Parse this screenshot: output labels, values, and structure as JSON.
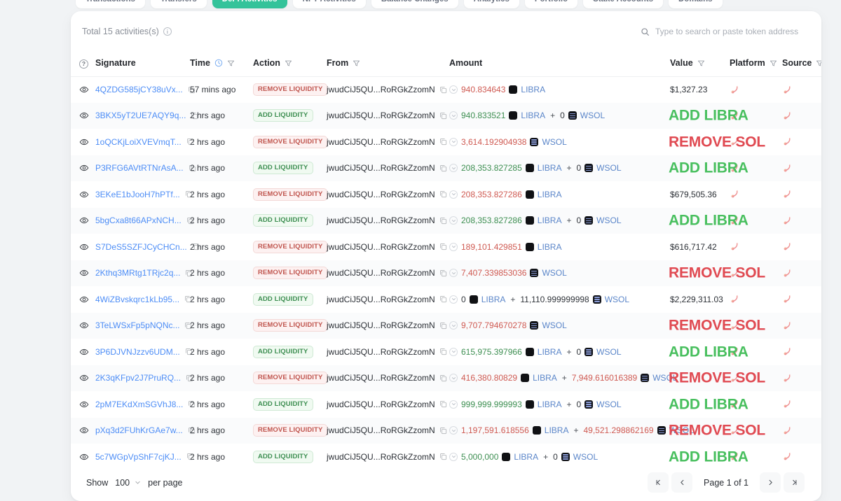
{
  "tabs": [
    {
      "label": "Transactions",
      "active": false
    },
    {
      "label": "Transfers",
      "active": false
    },
    {
      "label": "DeFi Activities",
      "active": true
    },
    {
      "label": "NFT Activities",
      "active": false
    },
    {
      "label": "Balance Changes",
      "active": false
    },
    {
      "label": "Analytics",
      "active": false
    },
    {
      "label": "Portfolio",
      "active": false
    },
    {
      "label": "Stake Accounts",
      "active": false
    },
    {
      "label": "Domains",
      "active": false
    }
  ],
  "header": {
    "total_label": "Total 15 activities(s)",
    "search_placeholder": "Type to search or paste token address",
    "search_value": ""
  },
  "columns": {
    "signature": "Signature",
    "time": "Time",
    "action": "Action",
    "from": "From",
    "amount": "Amount",
    "value": "Value",
    "platform": "Platform",
    "source": "Source"
  },
  "rows": [
    {
      "signature": "4QZDG585jCY38uVx...",
      "time": "57 mins ago",
      "action": "REMOVE LIQUIDITY",
      "action_type": "remove",
      "from": "jwudCiJ5QU...RoRGkZzomN",
      "amount": [
        {
          "num": "940.834643",
          "sign": "neg",
          "token": "LIBRA",
          "icon": "libra"
        }
      ],
      "value": "$1,327.23",
      "big_value": null
    },
    {
      "signature": "3BKX5yT2UE7AQY9q...",
      "time": "2 hrs ago",
      "action": "ADD LIQUIDITY",
      "action_type": "add",
      "from": "jwudCiJ5QU...RoRGkZzomN",
      "amount": [
        {
          "num": "940.833521",
          "sign": "pos",
          "token": "LIBRA",
          "icon": "libra"
        },
        {
          "num": "0",
          "sign": "plain",
          "token": "WSOL",
          "icon": "wsol"
        }
      ],
      "value": null,
      "big_value": "ADD LIBRA",
      "big_type": "add"
    },
    {
      "signature": "1oQCKjLoiXVEVmqT...",
      "time": "2 hrs ago",
      "action": "REMOVE LIQUIDITY",
      "action_type": "remove",
      "from": "jwudCiJ5QU...RoRGkZzomN",
      "amount": [
        {
          "num": "3,614.192904938",
          "sign": "neg",
          "token": "WSOL",
          "icon": "wsol"
        }
      ],
      "value": null,
      "big_value": "REMOVE SOL",
      "big_type": "rem"
    },
    {
      "signature": "P3RFG6AVtRTNrAsA...",
      "time": "2 hrs ago",
      "action": "ADD LIQUIDITY",
      "action_type": "add",
      "from": "jwudCiJ5QU...RoRGkZzomN",
      "amount": [
        {
          "num": "208,353.827285",
          "sign": "pos",
          "token": "LIBRA",
          "icon": "libra"
        },
        {
          "num": "0",
          "sign": "plain",
          "token": "WSOL",
          "icon": "wsol"
        }
      ],
      "value": null,
      "big_value": "ADD LIBRA",
      "big_type": "add"
    },
    {
      "signature": "3EKeE1bJooH7hPTf...",
      "time": "2 hrs ago",
      "action": "REMOVE LIQUIDITY",
      "action_type": "remove",
      "from": "jwudCiJ5QU...RoRGkZzomN",
      "amount": [
        {
          "num": "208,353.827286",
          "sign": "neg",
          "token": "LIBRA",
          "icon": "libra"
        }
      ],
      "value": "$679,505.36",
      "big_value": null
    },
    {
      "signature": "5bgCxa8t66APxNCH...",
      "time": "2 hrs ago",
      "action": "ADD LIQUIDITY",
      "action_type": "add",
      "from": "jwudCiJ5QU...RoRGkZzomN",
      "amount": [
        {
          "num": "208,353.827286",
          "sign": "pos",
          "token": "LIBRA",
          "icon": "libra"
        },
        {
          "num": "0",
          "sign": "plain",
          "token": "WSOL",
          "icon": "wsol"
        }
      ],
      "value": null,
      "big_value": "ADD LIBRA",
      "big_type": "add"
    },
    {
      "signature": "S7DeS5SZFJCyCHCn...",
      "time": "2 hrs ago",
      "action": "REMOVE LIQUIDITY",
      "action_type": "remove",
      "from": "jwudCiJ5QU...RoRGkZzomN",
      "amount": [
        {
          "num": "189,101.429851",
          "sign": "neg",
          "token": "LIBRA",
          "icon": "libra"
        }
      ],
      "value": "$616,717.42",
      "big_value": null
    },
    {
      "signature": "2Kthq3MRtg1TRjc2q...",
      "time": "2 hrs ago",
      "action": "REMOVE LIQUIDITY",
      "action_type": "remove",
      "from": "jwudCiJ5QU...RoRGkZzomN",
      "amount": [
        {
          "num": "7,407.339853036",
          "sign": "neg",
          "token": "WSOL",
          "icon": "wsol"
        }
      ],
      "value": null,
      "big_value": "REMOVE SOL",
      "big_type": "rem"
    },
    {
      "signature": "4WiZBvskqrc1kLb95...",
      "time": "2 hrs ago",
      "action": "ADD LIQUIDITY",
      "action_type": "add",
      "from": "jwudCiJ5QU...RoRGkZzomN",
      "amount": [
        {
          "num": "0",
          "sign": "plain",
          "token": "LIBRA",
          "icon": "libra"
        },
        {
          "num": "11,110.999999998",
          "sign": "plain",
          "token": "WSOL",
          "icon": "wsol"
        }
      ],
      "value": "$2,229,311.03",
      "big_value": null
    },
    {
      "signature": "3TeLWSxFp5pNQNc...",
      "time": "2 hrs ago",
      "action": "REMOVE LIQUIDITY",
      "action_type": "remove",
      "from": "jwudCiJ5QU...RoRGkZzomN",
      "amount": [
        {
          "num": "9,707.794670278",
          "sign": "neg",
          "token": "WSOL",
          "icon": "wsol"
        }
      ],
      "value": null,
      "big_value": "REMOVE SOL",
      "big_type": "rem"
    },
    {
      "signature": "3P6DJVNJzzv6UDM...",
      "time": "2 hrs ago",
      "action": "ADD LIQUIDITY",
      "action_type": "add",
      "from": "jwudCiJ5QU...RoRGkZzomN",
      "amount": [
        {
          "num": "615,975.397966",
          "sign": "pos",
          "token": "LIBRA",
          "icon": "libra"
        },
        {
          "num": "0",
          "sign": "plain",
          "token": "WSOL",
          "icon": "wsol"
        }
      ],
      "value": null,
      "big_value": "ADD LIBRA",
      "big_type": "add"
    },
    {
      "signature": "2K3qKFpv2J7PruRQ...",
      "time": "2 hrs ago",
      "action": "REMOVE LIQUIDITY",
      "action_type": "remove",
      "from": "jwudCiJ5QU...RoRGkZzomN",
      "amount": [
        {
          "num": "416,380.80829",
          "sign": "neg",
          "token": "LIBRA",
          "icon": "libra"
        },
        {
          "num": "7,949.616016389",
          "sign": "neg",
          "token": "WSOL",
          "icon": "wsol"
        }
      ],
      "value": null,
      "big_value": "REMOVE SOL",
      "big_type": "rem"
    },
    {
      "signature": "2pM7EKdXmSGVhJ8...",
      "time": "2 hrs ago",
      "action": "ADD LIQUIDITY",
      "action_type": "add",
      "from": "jwudCiJ5QU...RoRGkZzomN",
      "amount": [
        {
          "num": "999,999.999993",
          "sign": "pos",
          "token": "LIBRA",
          "icon": "libra"
        },
        {
          "num": "0",
          "sign": "plain",
          "token": "WSOL",
          "icon": "wsol"
        }
      ],
      "value": null,
      "big_value": "ADD LIBRA",
      "big_type": "add"
    },
    {
      "signature": "pXq3d2FUhKrGAe7w...",
      "time": "2 hrs ago",
      "action": "REMOVE LIQUIDITY",
      "action_type": "remove",
      "from": "jwudCiJ5QU...RoRGkZzomN",
      "amount": [
        {
          "num": "1,197,591.618556",
          "sign": "neg",
          "token": "LIBRA",
          "icon": "libra"
        },
        {
          "num": "49,521.298862169",
          "sign": "neg",
          "token": "WSOL",
          "icon": "wsol"
        }
      ],
      "value": null,
      "big_value": "REMOVE SOL",
      "big_type": "rem"
    },
    {
      "signature": "5c7WGpVpShF7cjKJ...",
      "time": "2 hrs ago",
      "action": "ADD LIQUIDITY",
      "action_type": "add",
      "from": "jwudCiJ5QU...RoRGkZzomN",
      "amount": [
        {
          "num": "5,000,000",
          "sign": "pos",
          "token": "LIBRA",
          "icon": "libra"
        },
        {
          "num": "0",
          "sign": "plain",
          "token": "WSOL",
          "icon": "wsol"
        }
      ],
      "value": null,
      "big_value": "ADD LIBRA",
      "big_type": "add"
    }
  ],
  "footer": {
    "show_label": "Show",
    "page_size": "100",
    "per_page_label": "per page",
    "page_label": "Page 1 of 1"
  },
  "colors": {
    "accent": "#34c39a",
    "link": "#4d8df6",
    "positive": "#3e8f52",
    "negative": "#cf5a52",
    "big_add": "#48bf5e",
    "big_remove": "#e04a52"
  }
}
